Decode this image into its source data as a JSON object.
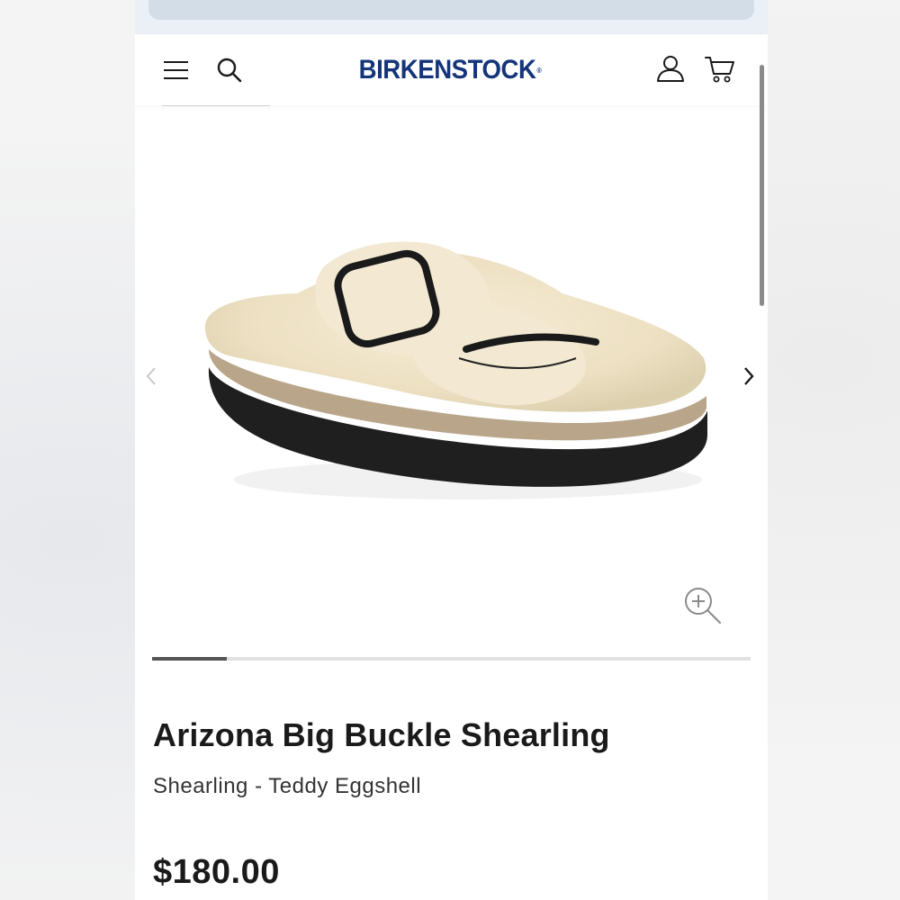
{
  "header": {
    "brand": "BIRKENSTOCK",
    "brand_mark": "®",
    "brand_color": "#14357a",
    "icons": [
      "menu-icon",
      "search-icon",
      "account-icon",
      "cart-icon"
    ]
  },
  "gallery": {
    "image_subject": "shearling-sandal",
    "current_slide_fraction": 0.125,
    "icons": [
      "chevron-left-icon",
      "chevron-right-icon",
      "zoom-in-icon"
    ]
  },
  "product": {
    "title": "Arizona Big Buckle Shearling",
    "variant": "Shearling - Teddy Eggshell",
    "price": "$180.00"
  },
  "colors": {
    "text": "#1a1a1a",
    "progress_fill": "#555555",
    "progress_track": "#e1e1e1",
    "urlbar": "#d3dde8"
  }
}
